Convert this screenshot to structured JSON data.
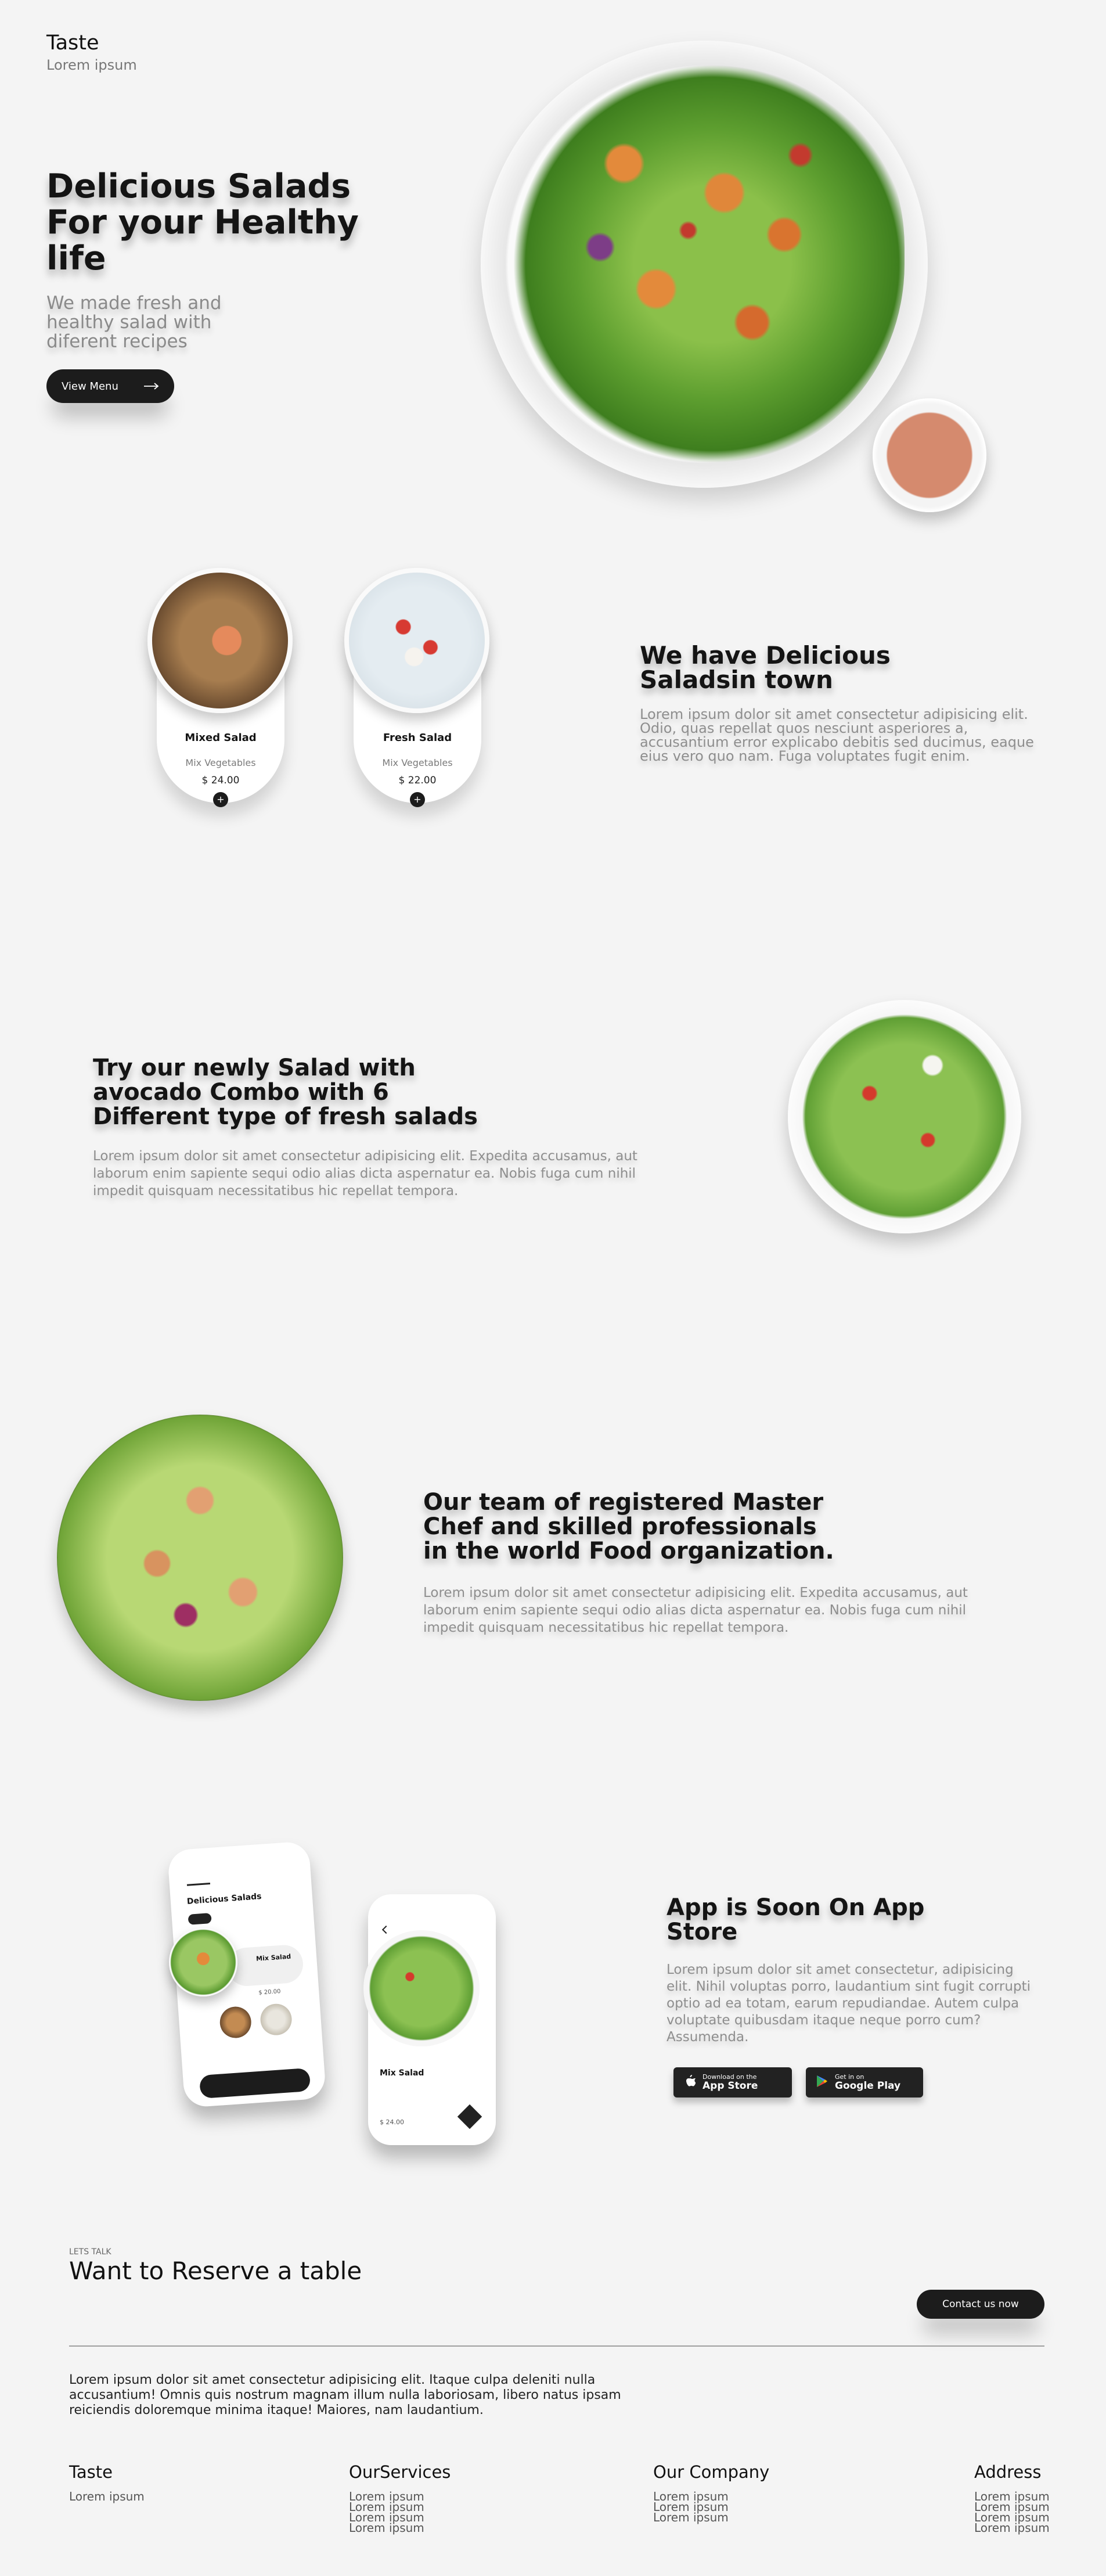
{
  "header": {
    "brand": "Taste",
    "brand_sub": "Lorem ipsum"
  },
  "hero": {
    "title": "Delicious Salads For your Healthy life",
    "text": "We made fresh and healthy salad with diferent recipes",
    "button_label": "View Menu",
    "button_icon": "arrow-right-icon"
  },
  "menu_cards": [
    {
      "name": "Mixed Salad",
      "desc": "Mix Vegetables",
      "price": "$ 24.00",
      "add_icon": "plus-icon"
    },
    {
      "name": "Fresh Salad",
      "desc": "Mix Vegetables",
      "price": "$ 22.00",
      "add_icon": "plus-icon"
    }
  ],
  "section_delicious": {
    "title": "We have Delicious Saladsin town",
    "text": "Lorem ipsum dolor sit amet consectetur adipisicing elit. Odio, quas repellat quos nesciunt asperiores a, accusantium error explicabo debitis sed ducimus, eaque eius vero quo nam. Fuga voluptates fugit enim."
  },
  "section_avocado": {
    "title": "Try our newly Salad with avocado Combo with 6 Different type of fresh salads",
    "text": "Lorem ipsum dolor sit amet consectetur adipisicing elit. Expedita accusamus, aut laborum enim sapiente sequi odio alias dicta aspernatur ea. Nobis fuga cum nihil impedit quisquam necessitatibus hic repellat tempora."
  },
  "section_chef": {
    "title": "Our team of registered Master Chef and skilled professionals in the world Food organization.",
    "text": "Lorem ipsum dolor sit amet consectetur adipisicing elit. Expedita accusamus, aut laborum enim sapiente sequi odio alias dicta aspernatur ea. Nobis fuga cum nihil impedit quisquam necessitatibus hic repellat tempora."
  },
  "section_app": {
    "title": "App is Soon On App Store",
    "text": "Lorem ipsum dolor sit amet consectetur, adipisicing elit. Nihil voluptas porro, laudantium sint fugit corrupti optio ad ea totam, earum repudiandae. Autem culpa voluptate quibusdam itaque neque porro cum? Assumenda.",
    "app_store": {
      "small": "Download on the",
      "big": "App Store",
      "icon": "apple-icon"
    },
    "google_play": {
      "small": "Get in on",
      "big": "Google Play",
      "icon": "play-store-icon"
    },
    "phone1": {
      "title": "Delicious Salads",
      "item": "Mix Salad",
      "price": "$ 20.00"
    },
    "phone2": {
      "title": "Mix Salad",
      "price": "$ 24.00"
    }
  },
  "reserve": {
    "eyebrow": "LETS TALK",
    "title": "Want to Reserve a table",
    "button_label": "Contact us now",
    "text": "Lorem ipsum dolor sit amet consectetur adipisicing elit. Itaque culpa deleniti nulla accusantium! Omnis quis nostrum magnam illum nulla laboriosam, libero natus ipsam reiciendis doloremque minima itaque! Maiores, nam laudantium."
  },
  "footer": {
    "col1": {
      "title": "Taste",
      "items": [
        "Lorem ipsum"
      ]
    },
    "col2": {
      "title": "OurServices",
      "items": [
        "Lorem ipsum",
        "Lorem ipsum",
        "Lorem ipsum",
        "Lorem ipsum"
      ]
    },
    "col3": {
      "title": "Our Company",
      "items": [
        "Lorem ipsum",
        "Lorem ipsum",
        "Lorem ipsum"
      ]
    },
    "col4": {
      "title": "Address",
      "items": [
        "Lorem ipsum",
        "Lorem ipsum",
        "Lorem ipsum",
        "Lorem ipsum"
      ]
    }
  },
  "colors": {
    "background": "#f4f4f4",
    "dark": "#1c1c1c",
    "text": "#141414",
    "muted": "#8e8e8e"
  }
}
